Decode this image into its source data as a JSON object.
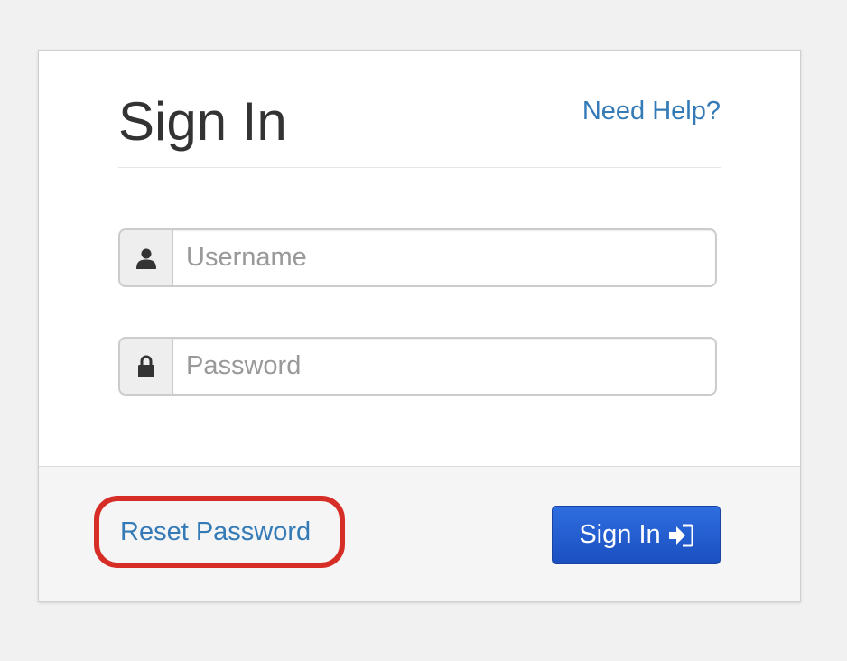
{
  "header": {
    "title": "Sign In",
    "help_link": "Need Help?"
  },
  "form": {
    "username": {
      "placeholder": "Username",
      "value": "",
      "icon": "user-icon"
    },
    "password": {
      "placeholder": "Password",
      "value": "",
      "icon": "lock-icon"
    }
  },
  "footer": {
    "reset_link": "Reset Password",
    "signin_button": "Sign In",
    "signin_icon": "sign-in-icon"
  },
  "colors": {
    "link": "#337ab7",
    "button": "#1f5bd0",
    "highlight": "#d62e26"
  }
}
